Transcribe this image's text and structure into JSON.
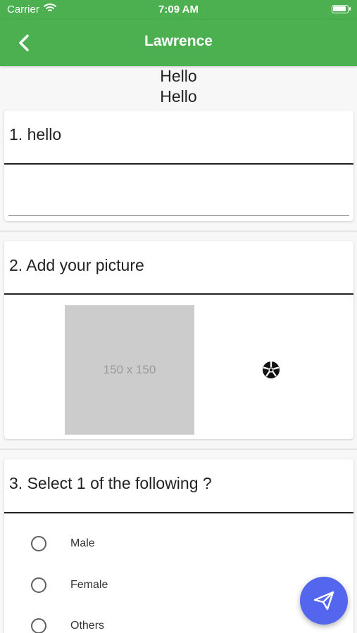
{
  "status_bar": {
    "carrier": "Carrier",
    "time": "7:09 AM"
  },
  "app_bar": {
    "title": "Lawrence",
    "back_icon": "chevron-left-icon"
  },
  "header": {
    "line1": "Hello",
    "line2": "Hello"
  },
  "questions": [
    {
      "title": "1. hello",
      "type": "text",
      "value": ""
    },
    {
      "title": "2. Add your picture",
      "type": "image",
      "placeholder_text": "150 x 150",
      "action_icon": "camera-shutter-icon"
    },
    {
      "title": "3. Select 1 of the following ?",
      "type": "radio",
      "options": [
        "Male",
        "Female",
        "Others"
      ],
      "selected": null
    }
  ],
  "fab": {
    "icon": "send-icon",
    "color": "#5466ee"
  },
  "colors": {
    "app_bar": "#4caf50",
    "placeholder_bg": "#cccccc"
  }
}
